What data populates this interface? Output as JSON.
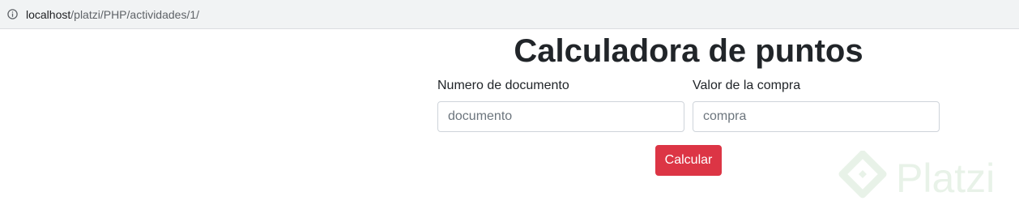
{
  "browser": {
    "url_host": "localhost",
    "url_path": "/platzi/PHP/actividades/1/",
    "info_icon": "info-icon"
  },
  "page": {
    "title": "Calculadora de puntos"
  },
  "form": {
    "document_label": "Numero de documento",
    "document_placeholder": "documento",
    "document_value": "",
    "purchase_label": "Valor de la compra",
    "purchase_placeholder": "compra",
    "purchase_value": "",
    "submit_label": "Calcular",
    "submit_color": "#dc3545"
  },
  "watermark": {
    "text": "Platzi",
    "logo_icon": "platzi-logo-icon",
    "color": "#98c99b"
  }
}
